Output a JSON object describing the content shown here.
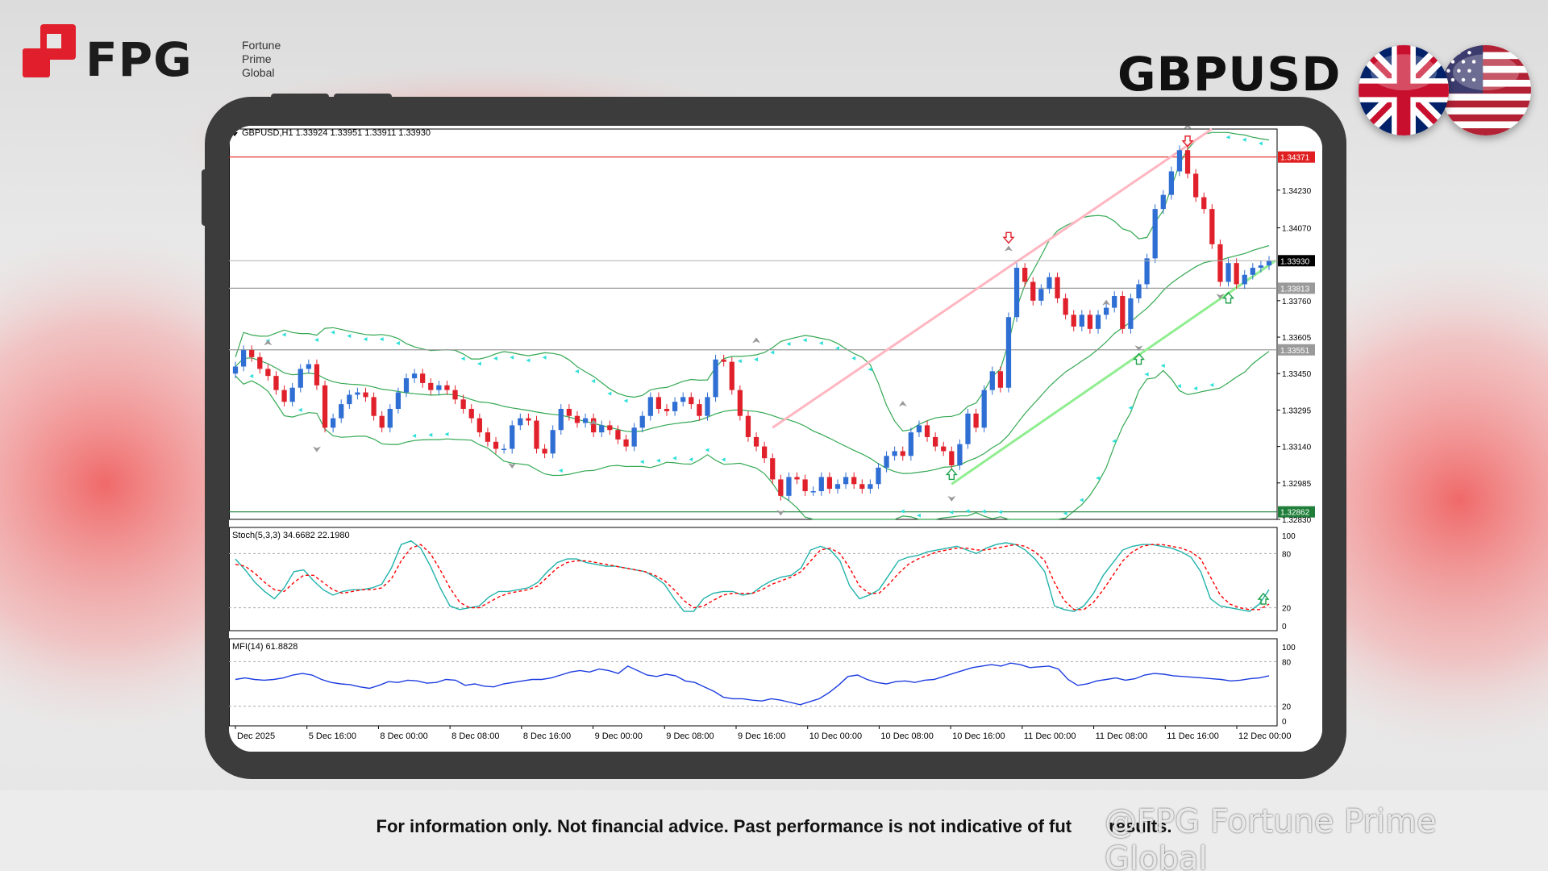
{
  "brand": {
    "name": "FPG",
    "sub_lines": [
      "Fortune",
      "Prime",
      "Global"
    ]
  },
  "pair_title": "GBPUSD",
  "flags": [
    "uk-flag-icon",
    "us-flag-icon"
  ],
  "disclaimer": "For information only. Not financial advice. Past performance is not indicative of fut",
  "disclaimer_tail": "results.",
  "watermark": "@FPG Fortune Prime Global",
  "colors": {
    "brand_red": "#e11f2c",
    "bull": "#2f6ed3",
    "bear": "#e0202a",
    "bollinger": "#33a852",
    "sar": "#2ee0d8",
    "channel_upper": "#ffb6c1",
    "channel_lower": "#90ee90",
    "resistance": "#e02020",
    "support": "#1f7f3a",
    "stoch_main": "#20b2aa",
    "stoch_signal": "#ff0000",
    "mfi": "#1d3de0"
  },
  "chart_data": {
    "type": "candlestick",
    "title": "GBPUSD,H1",
    "ohlc_label": "1.33924 1.33951 1.33911 1.33930",
    "last_price": "1.33930",
    "ylim": [
      1.3283,
      1.3449
    ],
    "price_ticks": [
      "1.34230",
      "1.34070",
      "1.33760",
      "1.33605",
      "1.33450",
      "1.33295",
      "1.33140",
      "1.32985",
      "1.32830"
    ],
    "levels": [
      {
        "label": "1.34371",
        "value": 1.34371,
        "kind": "resistance"
      },
      {
        "label": "1.33813",
        "value": 1.33813,
        "kind": "level"
      },
      {
        "label": "1.33551",
        "value": 1.33551,
        "kind": "level"
      },
      {
        "label": "1.32862",
        "value": 1.32862,
        "kind": "support"
      }
    ],
    "x_labels": [
      "Dec 2025",
      "5 Dec 16:00",
      "8 Dec 00:00",
      "8 Dec 08:00",
      "8 Dec 16:00",
      "9 Dec 00:00",
      "9 Dec 08:00",
      "9 Dec 16:00",
      "10 Dec 00:00",
      "10 Dec 08:00",
      "10 Dec 16:00",
      "11 Dec 00:00",
      "11 Dec 08:00",
      "11 Dec 16:00",
      "12 Dec 00:00"
    ],
    "closes": [
      1.3348,
      1.3355,
      1.3352,
      1.3347,
      1.3344,
      1.3338,
      1.3333,
      1.3339,
      1.3347,
      1.3349,
      1.334,
      1.3322,
      1.3326,
      1.3332,
      1.3336,
      1.3337,
      1.3335,
      1.3327,
      1.3322,
      1.333,
      1.3337,
      1.3343,
      1.3345,
      1.3341,
      1.3338,
      1.334,
      1.3338,
      1.3334,
      1.333,
      1.3326,
      1.332,
      1.3316,
      1.3313,
      1.3313,
      1.3323,
      1.3326,
      1.3325,
      1.3313,
      1.3311,
      1.3321,
      1.333,
      1.3327,
      1.3324,
      1.3326,
      1.332,
      1.3323,
      1.3321,
      1.3317,
      1.3314,
      1.3322,
      1.3327,
      1.3335,
      1.333,
      1.3329,
      1.3333,
      1.3335,
      1.3332,
      1.3327,
      1.3335,
      1.3351,
      1.335,
      1.3338,
      1.3327,
      1.3318,
      1.3314,
      1.3309,
      1.33,
      1.3293,
      1.3301,
      1.33,
      1.3295,
      1.3295,
      1.3301,
      1.3296,
      1.3298,
      1.3301,
      1.3298,
      1.3296,
      1.3298,
      1.3305,
      1.331,
      1.3312,
      1.331,
      1.332,
      1.3323,
      1.3318,
      1.3314,
      1.3312,
      1.3306,
      1.3315,
      1.3328,
      1.3322,
      1.3338,
      1.3346,
      1.3339,
      1.3369,
      1.339,
      1.3384,
      1.3376,
      1.3381,
      1.3386,
      1.3377,
      1.337,
      1.3365,
      1.337,
      1.3364,
      1.337,
      1.3373,
      1.3378,
      1.3364,
      1.3377,
      1.3383,
      1.3394,
      1.3415,
      1.3421,
      1.3431,
      1.344,
      1.343,
      1.342,
      1.3415,
      1.34,
      1.3384,
      1.3392,
      1.3383,
      1.3387,
      1.339,
      1.3391,
      1.3393
    ],
    "stoch_k": [
      74,
      62,
      48,
      38,
      30,
      42,
      60,
      62,
      50,
      40,
      34,
      38,
      40,
      40,
      42,
      46,
      64,
      90,
      94,
      86,
      66,
      42,
      22,
      18,
      20,
      22,
      32,
      38,
      38,
      40,
      42,
      48,
      60,
      70,
      74,
      74,
      70,
      68,
      66,
      66,
      64,
      62,
      60,
      54,
      46,
      30,
      16,
      16,
      30,
      36,
      38,
      38,
      34,
      36,
      44,
      50,
      54,
      56,
      64,
      84,
      88,
      84,
      72,
      44,
      30,
      34,
      40,
      56,
      72,
      76,
      78,
      82,
      84,
      86,
      88,
      84,
      80,
      86,
      90,
      92,
      90,
      84,
      74,
      60,
      22,
      18,
      16,
      22,
      36,
      56,
      70,
      84,
      88,
      90,
      90,
      88,
      86,
      82,
      76,
      60,
      30,
      22,
      20,
      18,
      16,
      24,
      40
    ],
    "stoch_d": [
      68,
      66,
      58,
      48,
      40,
      38,
      48,
      56,
      56,
      48,
      40,
      36,
      38,
      40,
      40,
      42,
      52,
      72,
      86,
      90,
      80,
      62,
      42,
      26,
      20,
      20,
      26,
      32,
      36,
      38,
      40,
      44,
      54,
      64,
      70,
      72,
      72,
      70,
      68,
      66,
      64,
      62,
      60,
      56,
      50,
      40,
      28,
      20,
      22,
      28,
      34,
      36,
      36,
      36,
      40,
      46,
      50,
      54,
      60,
      72,
      84,
      86,
      80,
      64,
      44,
      36,
      36,
      46,
      58,
      68,
      74,
      78,
      82,
      84,
      86,
      86,
      84,
      84,
      86,
      88,
      90,
      88,
      82,
      72,
      48,
      28,
      18,
      18,
      26,
      40,
      56,
      72,
      82,
      88,
      90,
      90,
      88,
      86,
      82,
      74,
      54,
      34,
      24,
      20,
      18,
      18,
      24
    ],
    "stoch_label": "Stoch(5,3,3) 34.6682 22.1980",
    "stoch_ticks": [
      "100",
      "80",
      "20",
      "0"
    ],
    "mfi": [
      56,
      58,
      56,
      55,
      56,
      58,
      62,
      64,
      62,
      56,
      52,
      50,
      49,
      46,
      44,
      48,
      53,
      52,
      55,
      54,
      51,
      52,
      56,
      55,
      48,
      50,
      47,
      46,
      50,
      52,
      54,
      56,
      56,
      58,
      62,
      66,
      68,
      66,
      70,
      68,
      64,
      74,
      68,
      62,
      60,
      63,
      61,
      54,
      52,
      46,
      40,
      32,
      30,
      30,
      28,
      27,
      30,
      28,
      25,
      22,
      26,
      30,
      38,
      48,
      60,
      62,
      56,
      52,
      50,
      53,
      54,
      52,
      55,
      56,
      60,
      64,
      68,
      72,
      74,
      76,
      74,
      78,
      76,
      72,
      73,
      74,
      70,
      56,
      48,
      50,
      54,
      56,
      58,
      55,
      57,
      62,
      64,
      63,
      61,
      60,
      59,
      58,
      57,
      56,
      54,
      55,
      57,
      58,
      61
    ],
    "mfi_label": "MFI(14) 61.8828",
    "mfi_ticks": [
      "100",
      "80",
      "20",
      "0"
    ]
  }
}
